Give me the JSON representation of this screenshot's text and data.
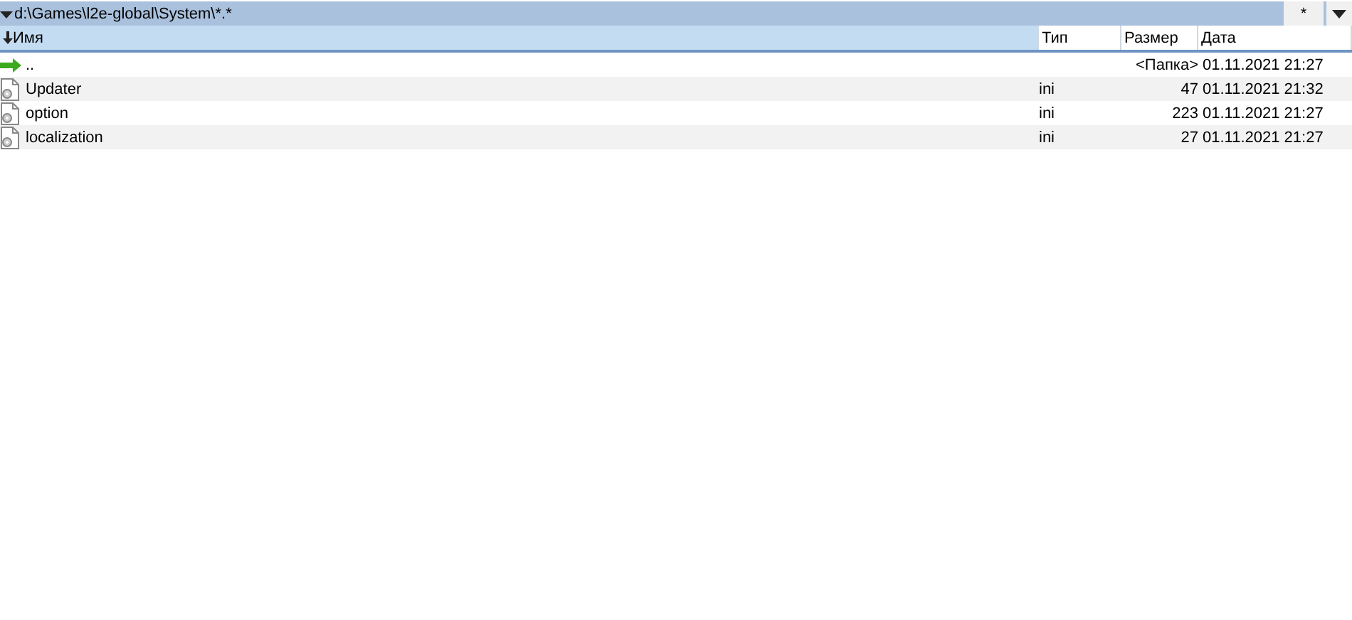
{
  "path_bar": {
    "path": "d:\\Games\\l2e-global\\System\\*.*",
    "filter_button": "*"
  },
  "columns": [
    {
      "label": "Имя",
      "sorted": true
    },
    {
      "label": "Тип",
      "sorted": false
    },
    {
      "label": "Размер",
      "sorted": false
    },
    {
      "label": "Дата",
      "sorted": false
    }
  ],
  "rows": [
    {
      "kind": "parent",
      "name": "..",
      "type": "",
      "size": "<Папка>",
      "date": "01.11.2021 21:27"
    },
    {
      "kind": "file",
      "name": "Updater",
      "type": "ini",
      "size": "47",
      "date": "01.11.2021 21:32"
    },
    {
      "kind": "file",
      "name": "option",
      "type": "ini",
      "size": "223",
      "date": "01.11.2021 21:27"
    },
    {
      "kind": "file",
      "name": "localization",
      "type": "ini",
      "size": "27",
      "date": "01.11.2021 21:27"
    }
  ]
}
